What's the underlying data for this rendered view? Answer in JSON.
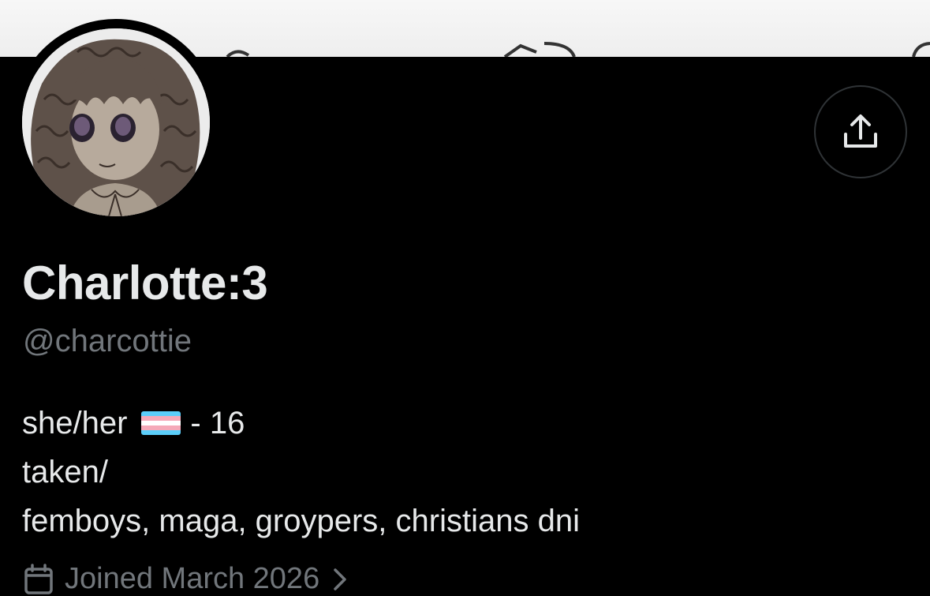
{
  "profile": {
    "display_name": "Charlotte:3",
    "handle": "@charcottie",
    "bio": {
      "line1_prefix": "she/her",
      "line1_flag_icon": "trans-flag-emoji",
      "line1_suffix": "- 16",
      "line2": "taken/",
      "line3": "femboys, maga, groypers, christians dni"
    },
    "joined_text": "Joined March 2026"
  },
  "icons": {
    "share": "share-upload-icon",
    "calendar": "calendar-icon",
    "chevron": "chevron-right-icon"
  },
  "colors": {
    "background": "#000000",
    "primary_text": "#e7e9ea",
    "secondary_text": "#71767b",
    "button_border": "#2f3336",
    "flag_blue": "#5bcefa",
    "flag_pink": "#f5a9b8",
    "flag_white": "#ffffff"
  }
}
